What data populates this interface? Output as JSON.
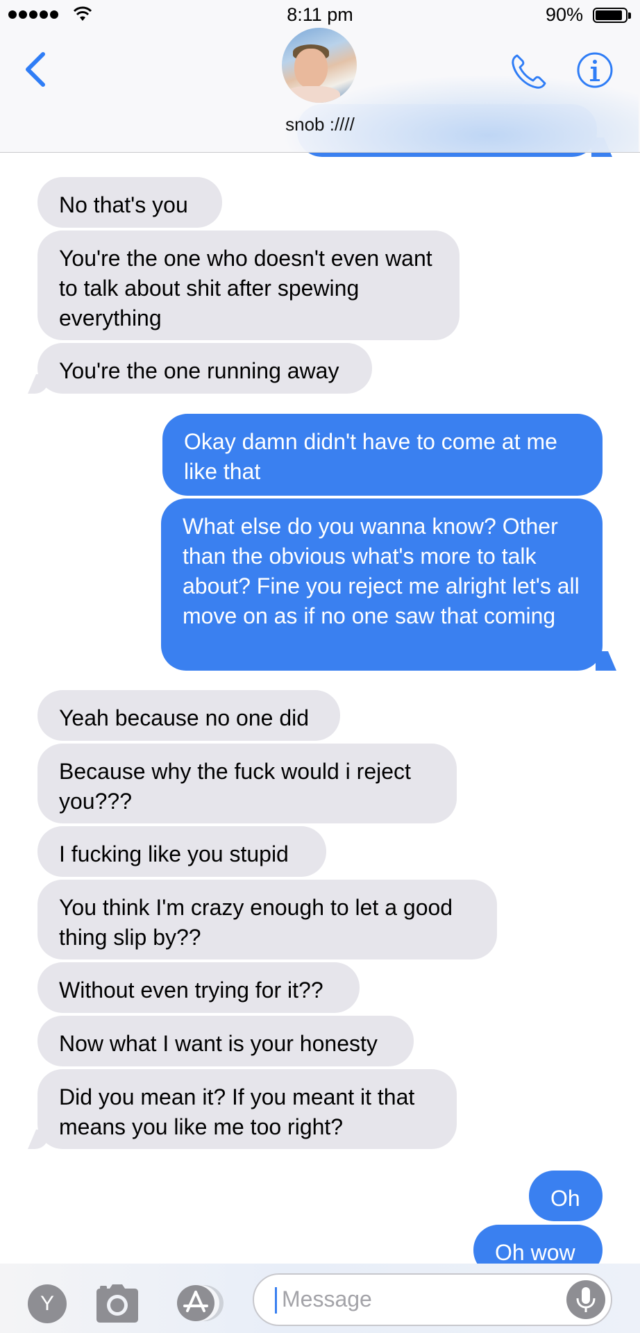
{
  "status_bar": {
    "time": "8:11 pm",
    "battery_percent": "90%",
    "battery_level": 0.9,
    "signal_bars": 5
  },
  "header": {
    "contact_name": "snob :////"
  },
  "messages": [
    {
      "direction": "in",
      "text": "No that's you"
    },
    {
      "direction": "in",
      "text": "You're the one who doesn't even want to talk about shit after spewing everything"
    },
    {
      "direction": "in",
      "text": "You're the one running away"
    },
    {
      "direction": "out",
      "text": "Okay damn didn't have to come at me like that"
    },
    {
      "direction": "out",
      "text": "What else do you wanna know? Other than the obvious what's more to talk about? Fine you reject me alright let's all move on as if no one saw that coming"
    },
    {
      "direction": "in",
      "text": "Yeah because no one did"
    },
    {
      "direction": "in",
      "text": "Because why the fuck would i reject you???"
    },
    {
      "direction": "in",
      "text": "I fucking like you stupid"
    },
    {
      "direction": "in",
      "text": "You think I'm crazy enough to let a good thing slip by??"
    },
    {
      "direction": "in",
      "text": "Without even trying for it??"
    },
    {
      "direction": "in",
      "text": "Now what I want is your honesty"
    },
    {
      "direction": "in",
      "text": "Did you mean it? If you meant it that means you like me too right?"
    },
    {
      "direction": "out",
      "text": "Oh"
    },
    {
      "direction": "out",
      "text": "Oh wow"
    }
  ],
  "composer": {
    "placeholder": "Message",
    "apps_button_label": "Y"
  },
  "colors": {
    "outgoing_bubble": "#3a80f0",
    "incoming_bubble": "#e6e5eb",
    "accent": "#2f7df6"
  },
  "icons": {
    "back": "chevron-left-icon",
    "call": "phone-icon",
    "info": "info-icon",
    "camera": "camera-icon",
    "app_store": "app-store-icon",
    "microphone": "microphone-icon"
  }
}
